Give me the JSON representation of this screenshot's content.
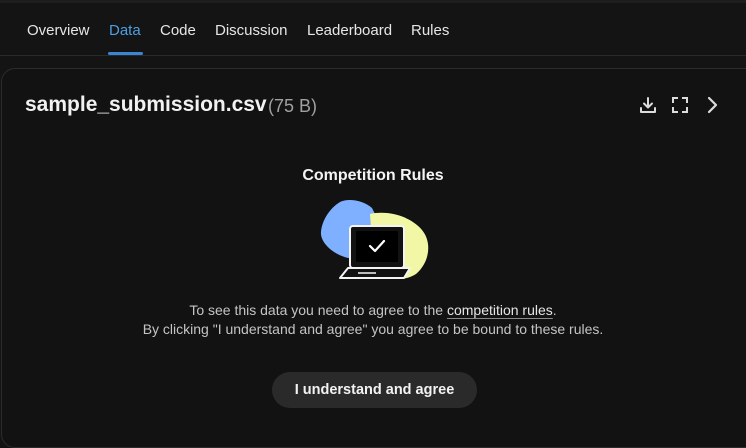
{
  "tabs": [
    {
      "label": "Overview",
      "active": false
    },
    {
      "label": "Data",
      "active": true
    },
    {
      "label": "Code",
      "active": false
    },
    {
      "label": "Discussion",
      "active": false
    },
    {
      "label": "Leaderboard",
      "active": false
    },
    {
      "label": "Rules",
      "active": false
    }
  ],
  "file": {
    "name": "sample_submission.csv",
    "size": "(75 B)",
    "actions": [
      "download-icon",
      "fullscreen-icon",
      "chevron-right-icon"
    ]
  },
  "rules_gate": {
    "heading": "Competition Rules",
    "line1_prefix": "To see this data you need to agree to the ",
    "line1_link": "competition rules",
    "line1_suffix": ".",
    "line2": "By clicking \"I understand and agree\" you agree to be bound to these rules.",
    "button": "I understand and agree"
  },
  "colors": {
    "background": "#141414",
    "accent": "#4d9fe3",
    "illustration_blue": "#7fb0ff",
    "illustration_yellow": "#f2f7a6"
  }
}
